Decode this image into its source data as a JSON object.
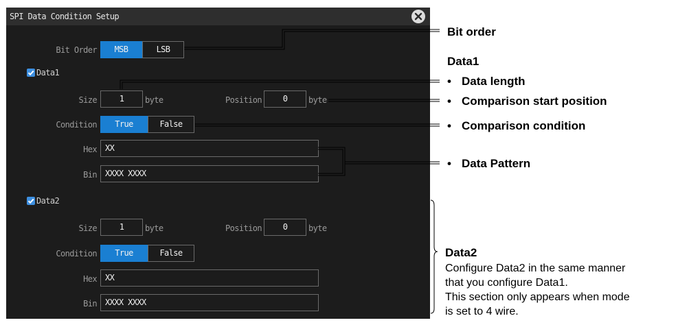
{
  "dialog": {
    "title": "SPI Data Condition Setup",
    "close_icon": "close-circle-icon",
    "bit_order": {
      "label": "Bit Order",
      "options": [
        "MSB",
        "LSB"
      ],
      "selected": "MSB"
    },
    "data1": {
      "checkbox_label": "Data1",
      "checked": true,
      "size_label": "Size",
      "size_value": "1",
      "size_unit": "byte",
      "position_label": "Position",
      "position_value": "0",
      "position_unit": "byte",
      "condition_label": "Condition",
      "condition_options": [
        "True",
        "False"
      ],
      "condition_selected": "True",
      "hex_label": "Hex",
      "hex_value": "XX",
      "bin_label": "Bin",
      "bin_value": "XXXX XXXX"
    },
    "data2": {
      "checkbox_label": "Data2",
      "checked": true,
      "size_label": "Size",
      "size_value": "1",
      "size_unit": "byte",
      "position_label": "Position",
      "position_value": "0",
      "position_unit": "byte",
      "condition_label": "Condition",
      "condition_options": [
        "True",
        "False"
      ],
      "condition_selected": "True",
      "hex_label": "Hex",
      "hex_value": "XX",
      "bin_label": "Bin",
      "bin_value": "XXXX XXXX"
    }
  },
  "annotations": {
    "bit_order": "Bit order",
    "data1_heading": "Data1",
    "bullet": "•",
    "data_length": "Data length",
    "comparison_start": "Comparison start position",
    "comparison_condition": "Comparison condition",
    "data_pattern": "Data Pattern",
    "data2_heading": "Data2",
    "data2_note": [
      "Configure Data2 in the same manner",
      "that you configure Data1.",
      "This section only appears when mode",
      "is set to 4 wire."
    ]
  }
}
